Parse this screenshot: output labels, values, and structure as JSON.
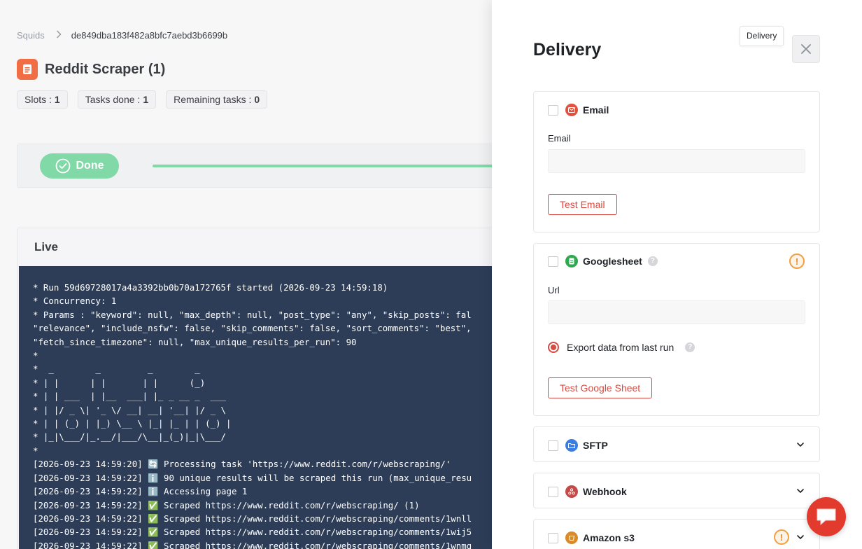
{
  "breadcrumb": {
    "root": "Squids",
    "current": "de849dba183f482a8bfc7aebd3b6699b"
  },
  "page": {
    "title": "Reddit Scraper (1)"
  },
  "badges": [
    {
      "label": "Slots :",
      "value": "1"
    },
    {
      "label": "Tasks done :",
      "value": "1"
    },
    {
      "label": "Remaining tasks :",
      "value": "0"
    }
  ],
  "status": {
    "label": "Done",
    "progress": 1.0
  },
  "live": {
    "title": "Live",
    "lines": [
      "* Run 59d69728017a4a3392bb0b70a172765f started (2026-09-23 14:59:18)",
      "* Concurrency: 1",
      "* Params : \"keyword\": null, \"max_depth\": null, \"post_type\": \"any\", \"skip_posts\": fal",
      "\"relevance\", \"include_nsfw\": false, \"skip_comments\": false, \"sort_comments\": \"best\",",
      "\"fetch_since_timezone\": null, \"max_unique_results_per_run\": 90",
      "*",
      "*  _        _         _        _",
      "* | |      | |       | |      (_)",
      "* | | ___  | |__  ___| |_ _ __ _  ___",
      "* | |/ _ \\| '_ \\/ __| __| '__| |/ _ \\",
      "* | | (_) | |_) \\__ \\ |_| |_ | | (_) |",
      "* |_|\\___/|_.__/|___/\\__|_(_)|_|\\___/",
      "*",
      "[2026-09-23 14:59:20] 🔄 Processing task 'https://www.reddit.com/r/webscraping/'",
      "[2026-09-23 14:59:22] ℹ️ 90 unique results will be scraped this run (max_unique_resu",
      "[2026-09-23 14:59:22] ℹ️ Accessing page 1",
      "[2026-09-23 14:59:22] ✅ Scraped https://www.reddit.com/r/webscraping/ (1)",
      "[2026-09-23 14:59:22] ✅ Scraped https://www.reddit.com/r/webscraping/comments/1wnll",
      "[2026-09-23 14:59:22] ✅ Scraped https://www.reddit.com/r/webscraping/comments/1wij5",
      "[2026-09-23 14:59:22] ✅ Scraped https://www.reddit.com/r/webscraping/comments/1wnmq"
    ]
  },
  "drawer": {
    "title": "Delivery",
    "tooltip": "Delivery",
    "close_icon": "close-icon",
    "sections": {
      "email": {
        "label": "Email",
        "field_label": "Email",
        "field_value": "",
        "button": "Test Email",
        "color": "#e0523f"
      },
      "googlesheet": {
        "label": "Googlesheet",
        "field_label": "Url",
        "field_value": "",
        "radio_label": "Export data from last run",
        "button": "Test Google Sheet",
        "color": "#2fa84f"
      },
      "sftp": {
        "label": "SFTP",
        "color": "#3b7de0"
      },
      "webhook": {
        "label": "Webhook",
        "color": "#c44a4a"
      },
      "s3": {
        "label": "Amazon s3",
        "color": "#d98a2b"
      }
    }
  },
  "colors": {
    "accent": "#d54b42",
    "done": "#6fd49b",
    "terminal_bg": "#112341"
  }
}
